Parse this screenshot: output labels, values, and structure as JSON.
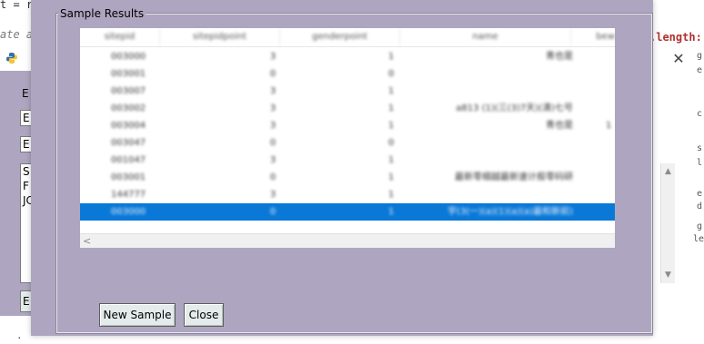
{
  "background": {
    "code_top_left": "t = r",
    "code_italic": "ate a",
    "code_length": ".length:",
    "code_bottom": "· ",
    "parent_window_letters": [
      "E",
      "S",
      "F",
      "JC"
    ],
    "parent_fields": [
      "E",
      "E"
    ],
    "parent_button_letter": "E",
    "parent_close_glyph": "✕",
    "right_text": [
      "g",
      "e",
      "c",
      "s",
      "l",
      "e",
      "d",
      "g",
      "le"
    ]
  },
  "dialog": {
    "group_title": "Sample Results",
    "table": {
      "columns": [
        "sitepid",
        "sitepidpoint",
        "genderpoint",
        "name",
        "bew"
      ],
      "rows": [
        {
          "id": "003000",
          "a": "3",
          "b": "1",
          "name": "青也是",
          "extra": ""
        },
        {
          "id": "003001",
          "a": "0",
          "b": "0",
          "name": "",
          "extra": ""
        },
        {
          "id": "003007",
          "a": "3",
          "b": "1",
          "name": "",
          "extra": ""
        },
        {
          "id": "003002",
          "a": "3",
          "b": "1",
          "name": "a813 (1)(三(3)7天)(清)七号",
          "extra": ""
        },
        {
          "id": "003004",
          "a": "3",
          "b": "1",
          "name": "青也是",
          "extra": "1"
        },
        {
          "id": "003047",
          "a": "0",
          "b": "0",
          "name": "",
          "extra": ""
        },
        {
          "id": "001047",
          "a": "3",
          "b": "1",
          "name": "",
          "extra": ""
        },
        {
          "id": "003001",
          "a": "0",
          "b": "1",
          "name": "最新零细越最新速计般零码研",
          "extra": ""
        },
        {
          "id": "144777",
          "a": "3",
          "b": "1",
          "name": "",
          "extra": ""
        },
        {
          "id": "003000",
          "a": "0",
          "b": "1",
          "name": "宇(3(一)(a)(1)(a)(a)最和新前)",
          "extra": ""
        }
      ],
      "selected_row_index": 9,
      "scroll_left_arrow": "<"
    },
    "buttons": {
      "new_sample": "New Sample",
      "close": "Close"
    }
  },
  "colors": {
    "dialog_bg": "#aea6c0",
    "selection": "#0a78d7",
    "button_bg": "#e4eceb"
  }
}
